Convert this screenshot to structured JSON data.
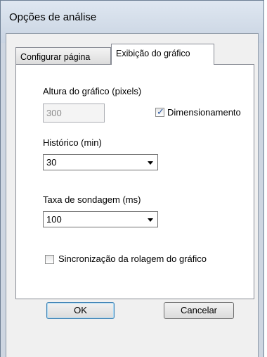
{
  "window": {
    "title": "Opções de análise"
  },
  "tabs": [
    {
      "label": "Configurar página",
      "active": false
    },
    {
      "label": "Exibição do gráfico",
      "active": true
    }
  ],
  "panel": {
    "chart_height": {
      "label": "Altura do gráfico (pixels)",
      "value": "300",
      "disabled": true
    },
    "sizing_checkbox": {
      "label": "Dimensionamento",
      "checked": true
    },
    "history": {
      "label": "Histórico (min)",
      "selected": "30"
    },
    "poll_rate": {
      "label": "Taxa de sondagem (ms)",
      "selected": "100"
    },
    "scroll_sync": {
      "label": "Sincronização da rolagem do gráfico",
      "checked": false
    }
  },
  "buttons": {
    "ok": "OK",
    "cancel": "Cancelar"
  },
  "icons": {
    "dropdown": "chevron-down-icon",
    "check": "checkmark-icon"
  },
  "colors": {
    "frame": "#ced6e1",
    "panel": "#ffffff",
    "check": "#2b5aa6"
  }
}
